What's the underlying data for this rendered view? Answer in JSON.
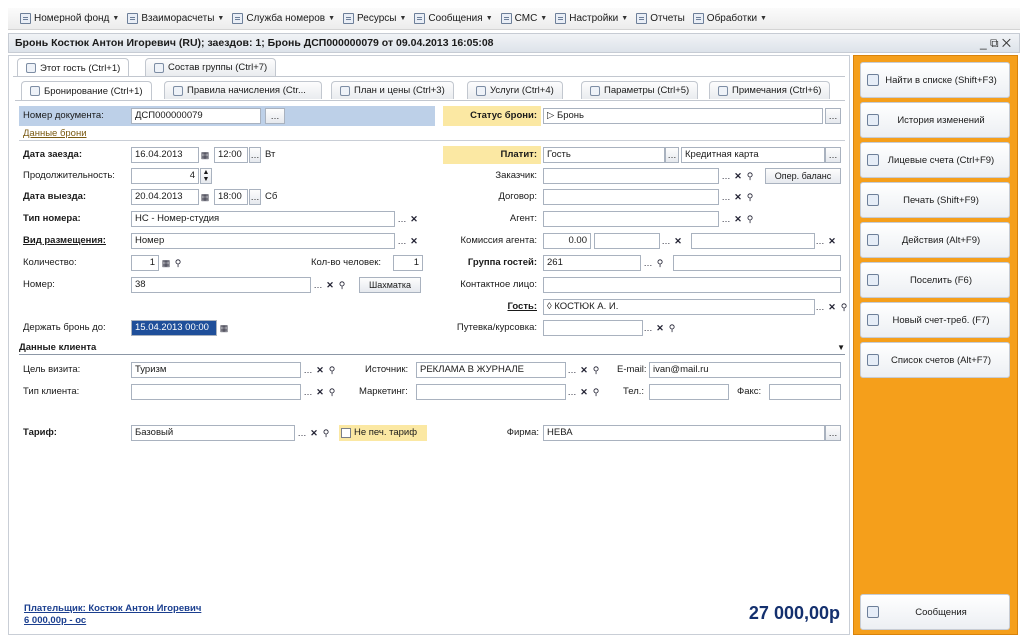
{
  "menu": {
    "items": [
      {
        "label": "Номерной фонд",
        "icon": "rooms-icon"
      },
      {
        "label": "Взаиморасчеты",
        "icon": "settlements-icon"
      },
      {
        "label": "Служба номеров",
        "icon": "housekeeping-icon"
      },
      {
        "label": "Ресурсы",
        "icon": "resources-icon"
      },
      {
        "label": "Сообщения",
        "icon": "messages-icon"
      },
      {
        "label": "СМС",
        "icon": "sms-icon"
      },
      {
        "label": "Настройки",
        "icon": "settings-icon"
      },
      {
        "label": "Отчеты",
        "icon": "reports-icon"
      },
      {
        "label": "Обработки",
        "icon": "processing-icon"
      }
    ]
  },
  "window": {
    "title": "Бронь Костюк Антон Игоревич (RU); заездов: 1; Бронь ДСП000000079 от 09.04.2013 16:05:08",
    "controls": "_ ⧉ ✕"
  },
  "tabs_top": [
    "Этот гость (Ctrl+1)",
    "Состав группы (Ctrl+7)"
  ],
  "tabs_inner": [
    "Бронирование (Ctrl+1)",
    "Правила начисления (Ctr...",
    "План и цены (Ctrl+3)",
    "Услуги (Ctrl+4)",
    "Параметры (Ctrl+5)",
    "Примечания (Ctrl+6)"
  ],
  "form": {
    "doc_number_label": "Номер документа:",
    "doc_number": "ДСП000000079",
    "status_label": "Статус брони:",
    "status_value": "Бронь",
    "section_booking": "Данные брони",
    "checkin_label": "Дата заезда:",
    "checkin_date": "16.04.2013",
    "checkin_time": "12:00",
    "checkin_dow": "Вт",
    "duration_label": "Продолжительность:",
    "duration": "4",
    "checkout_label": "Дата выезда:",
    "checkout_date": "20.04.2013",
    "checkout_time": "18:00",
    "checkout_dow": "Сб",
    "room_type_label": "Тип номера:",
    "room_type": "НС - Номер-студия",
    "accommodation_label": "Вид размещения:",
    "accommodation": "Номер",
    "quantity_label": "Количество:",
    "quantity": "1",
    "persons_label": "Кол-во человек:",
    "persons": "1",
    "room_label": "Номер:",
    "room": "38",
    "chess_button": "Шахматка",
    "hold_label": "Держать бронь до:",
    "hold_until": "15.04.2013 00:00",
    "payer_label": "Платит:",
    "payer": "Гость",
    "pay_method": "Кредитная карта",
    "customer_label": "Заказчик:",
    "balance_button": "Опер. баланс",
    "contract_label": "Договор:",
    "agent_label": "Агент:",
    "commission_label": "Комиссия агента:",
    "commission": "0.00",
    "group_label": "Группа гостей:",
    "group": "261",
    "contact_label": "Контактное лицо:",
    "guest_label": "Гость:",
    "guest": "КОСТЮК А. И.",
    "voucher_label": "Путевка/курсовка:",
    "section_client": "Данные клиента",
    "visit_purpose_label": "Цель визита:",
    "visit_purpose": "Туризм",
    "source_label": "Источник:",
    "source": "РЕКЛАМА В ЖУРНАЛЕ",
    "email_label": "E-mail:",
    "email": "ivan@mail.ru",
    "client_type_label": "Тип клиента:",
    "marketing_label": "Маркетинг:",
    "phone_label": "Тел.:",
    "fax_label": "Факс:",
    "tariff_label": "Тариф:",
    "tariff": "Базовый",
    "no_print_tariff": "Не печ. тариф",
    "firm_label": "Фирма:",
    "firm": "НЕВА"
  },
  "footer": {
    "payer_line": "Плательщик: Костюк Антон Игоревич",
    "payer_amount": "6 000,00р - ос",
    "total": "27 000,00р"
  },
  "actions": [
    {
      "label": "Найти в списке (Shift+F3)",
      "icon": "find-icon"
    },
    {
      "label": "История изменений",
      "icon": "history-icon"
    },
    {
      "label": "Лицевые счета (Ctrl+F9)",
      "icon": "accounts-icon"
    },
    {
      "label": "Печать (Shift+F9)",
      "icon": "print-icon"
    },
    {
      "label": "Действия (Alt+F9)",
      "icon": "actions-icon"
    },
    {
      "label": "Поселить (F6)",
      "icon": "checkin-icon"
    },
    {
      "label": "Новый счет-треб. (F7)",
      "icon": "invoice-icon"
    },
    {
      "label": "Список счетов (Alt+F7)",
      "icon": "invoices-list-icon"
    },
    {
      "label": "Сообщения",
      "icon": "messages-icon"
    }
  ],
  "colors": {
    "accent_panel": "#f59f1b",
    "highlight": "#fbe8a3",
    "header_blue": "#bdd0e8",
    "total_text": "#14306e"
  }
}
